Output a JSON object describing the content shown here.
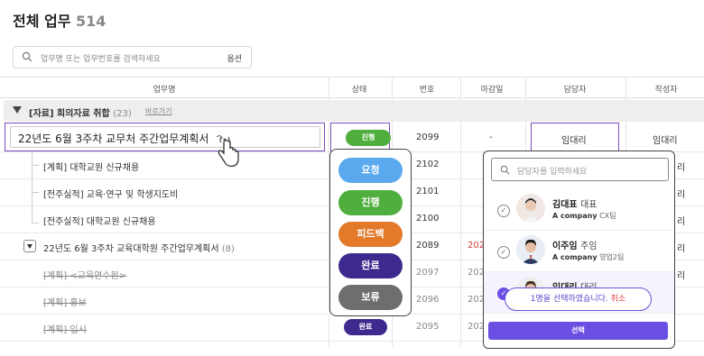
{
  "header": {
    "title": "전체 업무",
    "count": "514"
  },
  "search": {
    "placeholder": "업무명 또는 업무번호를 검색하세요",
    "option_label": "옵션"
  },
  "columns": {
    "name": "업무명",
    "status": "상태",
    "number": "번호",
    "deadline": "마감일",
    "assignee": "담당자",
    "author": "작성자"
  },
  "group": {
    "label": "[자료] 회의자료 취합",
    "count": "(23)",
    "link": "바로가기"
  },
  "active_task": {
    "name": "22년도 6월 3주차 교무처 주간업무계획서",
    "status": "진행",
    "number": "2099",
    "deadline": "-",
    "assignee": "임대리",
    "author": "임대리"
  },
  "subtasks": [
    {
      "name": "[계획] 대학교원 신규채용",
      "number": "2102"
    },
    {
      "name": "[전주실적] 교육·연구 및 학생지도비",
      "number": "2101"
    },
    {
      "name": "[전주실적] 대학교원 신규채용",
      "number": "2100"
    }
  ],
  "task2": {
    "name": "22년도 6월 3주차 교육대학원 주간업무계획서",
    "count": "(8)",
    "number": "2089",
    "deadline": "202"
  },
  "done_tasks": [
    {
      "name": "[계획] <교육연수원>",
      "number": "2097",
      "deadline": "202"
    },
    {
      "name": "[계획] 홍보",
      "number": "2096",
      "deadline": "202"
    },
    {
      "name": "[계획] 입시",
      "number": "2095",
      "deadline": "202",
      "status": "완료"
    }
  ],
  "author_partial": [
    "리",
    "리",
    "리",
    "리",
    "리"
  ],
  "status_options": [
    {
      "label": "요청",
      "color": "#5aa9ee"
    },
    {
      "label": "진행",
      "color": "#4fae3e"
    },
    {
      "label": "피드백",
      "color": "#e27a2a"
    },
    {
      "label": "완료",
      "color": "#3e2a8e"
    },
    {
      "label": "보류",
      "color": "#6e6e6e"
    }
  ],
  "assignee_picker": {
    "placeholder": "담당자를 입력하세요",
    "people": [
      {
        "name": "김대표",
        "rank": "대표",
        "company": "A company",
        "team": "CX팀"
      },
      {
        "name": "이주임",
        "rank": "주임",
        "company": "A company",
        "team": "영업2팀"
      },
      {
        "name": "임대리",
        "rank": "대리",
        "company": "",
        "team": ""
      }
    ],
    "toast_text": "1명을 선택하였습니다.",
    "toast_cancel": "취소",
    "select_label": "선택"
  },
  "colors": {
    "accent": "#6b4fe3",
    "highlight_border": "#7b4bbd",
    "deadline_red": "#d63c3c"
  }
}
